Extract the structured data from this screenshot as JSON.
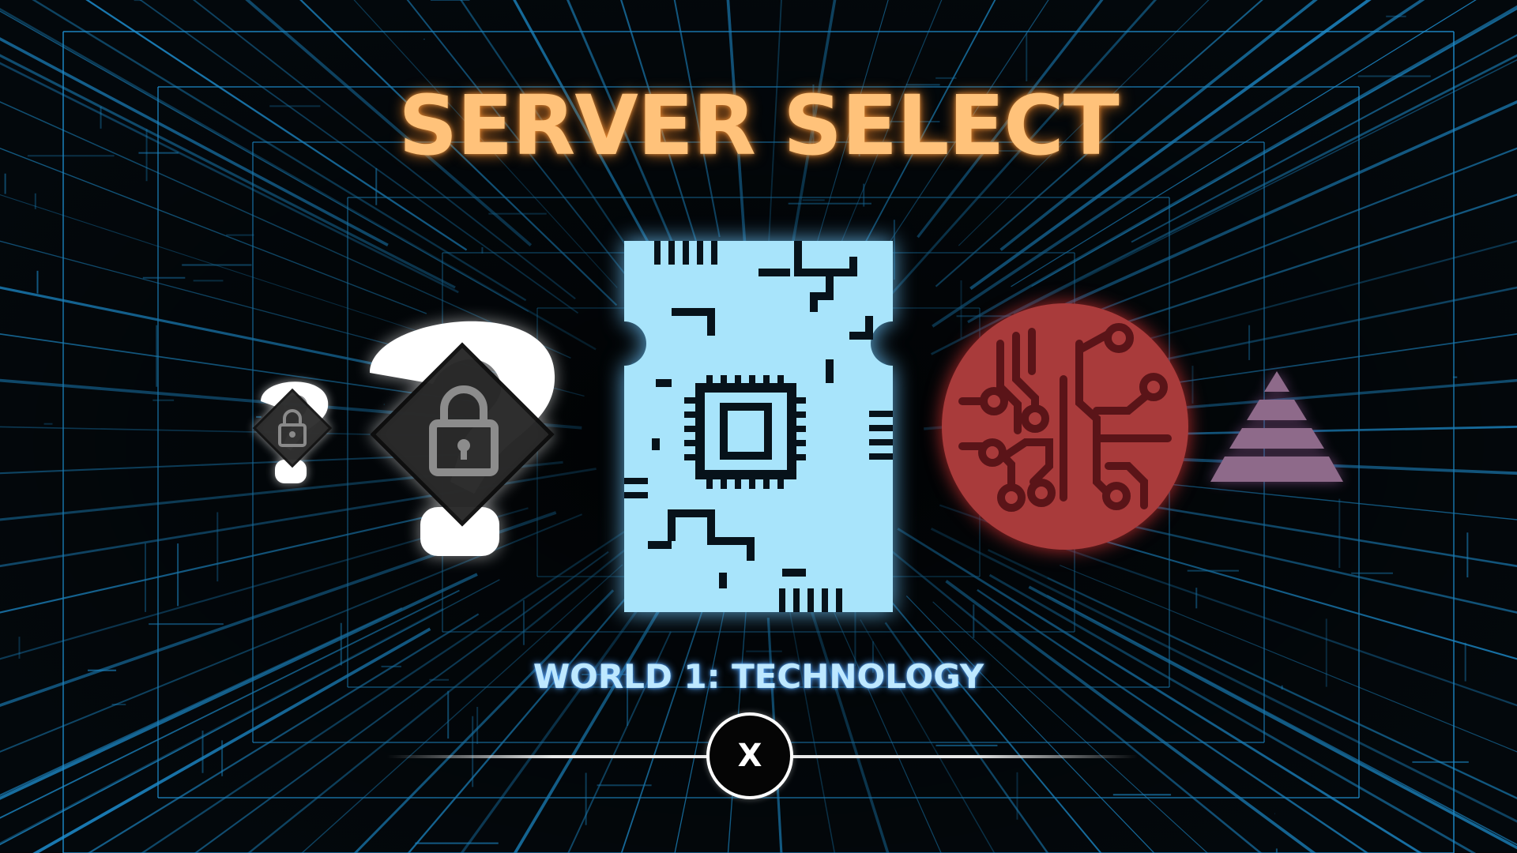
{
  "title": "SERVER SELECT",
  "worlds": [
    {
      "id": "locked-small",
      "state": "locked",
      "icon": "question-mark-lock-icon"
    },
    {
      "id": "locked-large",
      "state": "locked",
      "icon": "question-mark-lock-icon"
    },
    {
      "id": "technology",
      "state": "selected",
      "icon": "circuit-board-chip-icon"
    },
    {
      "id": "circuit",
      "state": "available",
      "icon": "circuit-nodes-icon"
    },
    {
      "id": "pyramid",
      "state": "available",
      "icon": "pyramid-icon"
    }
  ],
  "selected_world_label": "WORLD 1: TECHNOLOGY",
  "close_button": {
    "label": "X"
  },
  "colors": {
    "title": "#ffc27a",
    "title_glow": "#ff8c28",
    "world_label": "#bde8ff",
    "chip": "#a8e4fb",
    "circuit": "#a93b3b",
    "pyramid": "#8e6a8a",
    "grid_lines": "#1e8fd0"
  }
}
